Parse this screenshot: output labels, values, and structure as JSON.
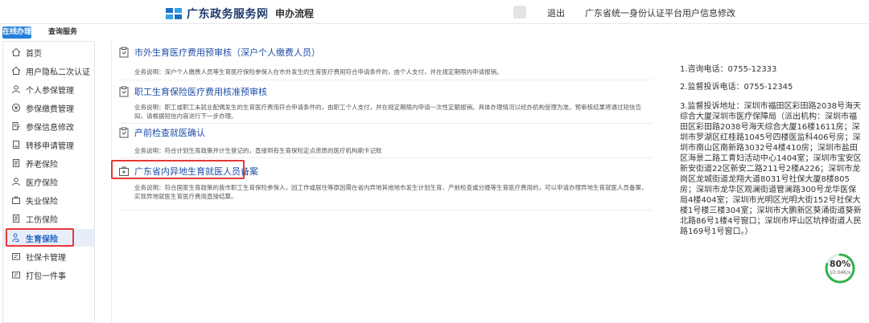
{
  "header": {
    "site_title": "广东政务服务网",
    "section": "申办流程",
    "logout": "退出",
    "update_info": "广东省统一身份认证平台用户信息修改"
  },
  "tabs": [
    {
      "label": "在线办理",
      "active": true
    },
    {
      "label": "查询服务",
      "active": false
    }
  ],
  "sidebar": {
    "items": [
      {
        "label": "首页",
        "icon": "home-icon"
      },
      {
        "label": "用户隐私二次认证",
        "icon": "home-icon"
      },
      {
        "label": "个人参保管理",
        "icon": "person-icon"
      },
      {
        "label": "参保缴费管理",
        "icon": "payment-icon"
      },
      {
        "label": "参保信息修改",
        "icon": "edit-doc-icon"
      },
      {
        "label": "转移申请管理",
        "icon": "transfer-doc-icon"
      },
      {
        "label": "养老保险",
        "icon": "doc-icon"
      },
      {
        "label": "医疗保险",
        "icon": "person-icon"
      },
      {
        "label": "失业保险",
        "icon": "briefcase-icon"
      },
      {
        "label": "工伤保险",
        "icon": "doc-icon"
      },
      {
        "label": "生育保险",
        "icon": "maternity-icon",
        "active": true
      },
      {
        "label": "社保卡管理",
        "icon": "card-icon"
      },
      {
        "label": "打包一件事",
        "icon": "card-icon"
      }
    ]
  },
  "services": [
    {
      "title": "市外生育医疗费用预审核（深户个人缴费人员）",
      "desc": "业务说明：深户个人缴费人员等生育医疗保险参保人在市外发生的生育医疗费用符合申请条件的，由个人支付，并在规定期限内申请报销。"
    },
    {
      "title": "职工生育保险医疗费用核准预审核",
      "desc": "业务说明：职工或职工未就业配偶发生的生育医疗费用符合申请条件的，由职工个人支付，并在规定期限内申请一次性定额报销。具体办理情况以经办机构受理为准。预审核结果将通过短信告知，请根据短信内容进行下一步办理。"
    },
    {
      "title": "产前检查就医确认",
      "desc": "业务说明：符合计划生育政策并计生登记的，直接到有生育保险定点资质的医疗机构刷卡记账"
    },
    {
      "title": "广东省内异地生育就医人员备案",
      "desc": "业务说明：符合国家生育政策的我市职工生育保险参保人，因工作或居住等原因需在省内异地其他地市发生计划生育、产前检查或分娩等生育医疗费用的，可以申请办理异地生育就医人员备案，实现异地就医生育医疗费用直接结算。"
    }
  ],
  "info": {
    "consult": "1.咨询电话：0755-12333",
    "complaint": "2.监督投诉电话：0755-12345",
    "address": "3.监督投诉地址：深圳市福田区彩田路2038号海天综合大厦深圳市医疗保障局（派出机构：深圳市福田区彩田路2038号海天综合大厦16楼1611房；深圳市罗湖区红桂路1045号四楼医监科406号房；深圳市南山区南新路3032号4楼410房；深圳市盐田区海景二路工青妇活动中心1404室；深圳市宝安区新安街道22区新安二路211号2楼A226；深圳市龙岗区龙城街道龙翔大道8031号社保大厦8楼805房；深圳市龙华区观澜街道管澜路300号龙华医保局4楼404室；深圳市光明区光明大街152号社保大楼1号楼三楼304室；深圳市大鹏新区葵涌街道葵新北路86号1楼4号窗口；深圳市坪山区坑梓街道人民路169号1号窗口。）"
  },
  "badge": {
    "percent": "80%",
    "speed": "10.04K/s",
    "progress": 0.8
  },
  "colors": {
    "accent": "#2680d9",
    "link": "#1f4ea8",
    "highlight": "#e53935"
  }
}
